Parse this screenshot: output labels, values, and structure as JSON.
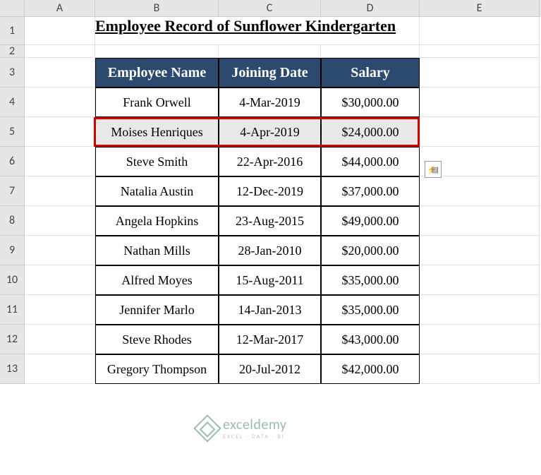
{
  "columns": [
    "A",
    "B",
    "C",
    "D",
    "E"
  ],
  "rows": [
    "1",
    "2",
    "3",
    "4",
    "5",
    "6",
    "7",
    "8",
    "9",
    "10",
    "11",
    "12",
    "13"
  ],
  "title": "Employee Record of Sunflower Kindergarten",
  "headers": {
    "name": "Employee Name",
    "date": "Joining Date",
    "salary": "Salary"
  },
  "chart_data": {
    "type": "table",
    "title": "Employee Record of Sunflower Kindergarten",
    "columns": [
      "Employee Name",
      "Joining Date",
      "Salary"
    ],
    "rows": [
      {
        "name": "Frank Orwell",
        "date": "4-Mar-2019",
        "salary": "$30,000.00"
      },
      {
        "name": "Moises Henriques",
        "date": "4-Apr-2019",
        "salary": "$24,000.00"
      },
      {
        "name": "Steve Smith",
        "date": "22-Apr-2016",
        "salary": "$44,000.00"
      },
      {
        "name": "Natalia Austin",
        "date": "12-Dec-2019",
        "salary": "$37,000.00"
      },
      {
        "name": "Angela Hopkins",
        "date": "23-Aug-2015",
        "salary": "$49,000.00"
      },
      {
        "name": "Nathan Mills",
        "date": "28-Jan-2010",
        "salary": "$20,000.00"
      },
      {
        "name": "Alfred Moyes",
        "date": "15-Aug-2011",
        "salary": "$35,000.00"
      },
      {
        "name": "Jennifer Marlo",
        "date": "14-Jan-2013",
        "salary": "$35,000.00"
      },
      {
        "name": "Steve Rhodes",
        "date": "12-Mar-2017",
        "salary": "$43,000.00"
      },
      {
        "name": "Gregory Thompson",
        "date": "20-Jul-2012",
        "salary": "$42,000.00"
      }
    ],
    "highlighted_row_index": 1
  },
  "watermark": {
    "main": "exceldemy",
    "sub": "EXCEL · DATA · BI"
  }
}
